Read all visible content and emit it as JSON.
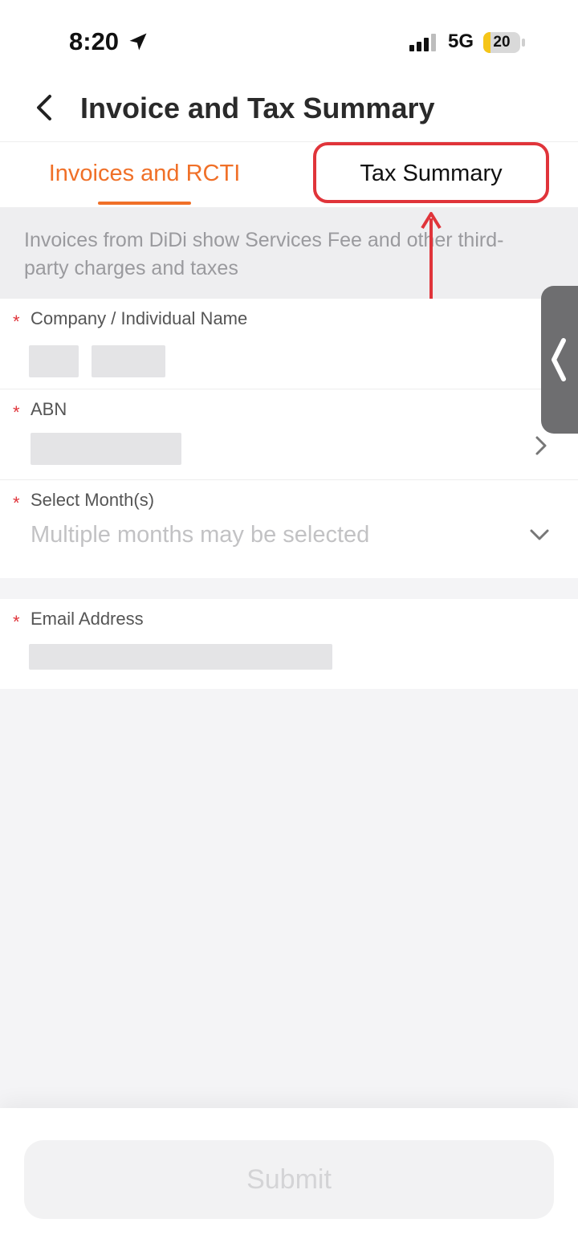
{
  "status_bar": {
    "time": "8:20",
    "network": "5G",
    "battery": "20",
    "battery_level": 0.2
  },
  "header": {
    "title": "Invoice and Tax Summary"
  },
  "tabs": [
    {
      "label": "Invoices and RCTI",
      "active": true
    },
    {
      "label": "Tax Summary",
      "active": false
    }
  ],
  "info": {
    "text": "Invoices from DiDi show Services Fee and other third-party charges and taxes"
  },
  "form": {
    "company_name": {
      "label": "Company / Individual Name",
      "required_mark": "*"
    },
    "abn": {
      "label": "ABN",
      "required_mark": "*"
    },
    "months": {
      "label": "Select Month(s)",
      "required_mark": "*",
      "placeholder": "Multiple months may be selected"
    },
    "email": {
      "label": "Email Address",
      "required_mark": "*"
    }
  },
  "submit": {
    "label": "Submit"
  },
  "colors": {
    "accent": "#f07028",
    "highlight": "#e0343a",
    "required": "#e0343a"
  },
  "icons": [
    "location-arrow-icon",
    "signal-icon",
    "back-arrow-icon",
    "chevron-right-icon",
    "chevron-down-icon",
    "collapse-handle-icon"
  ]
}
